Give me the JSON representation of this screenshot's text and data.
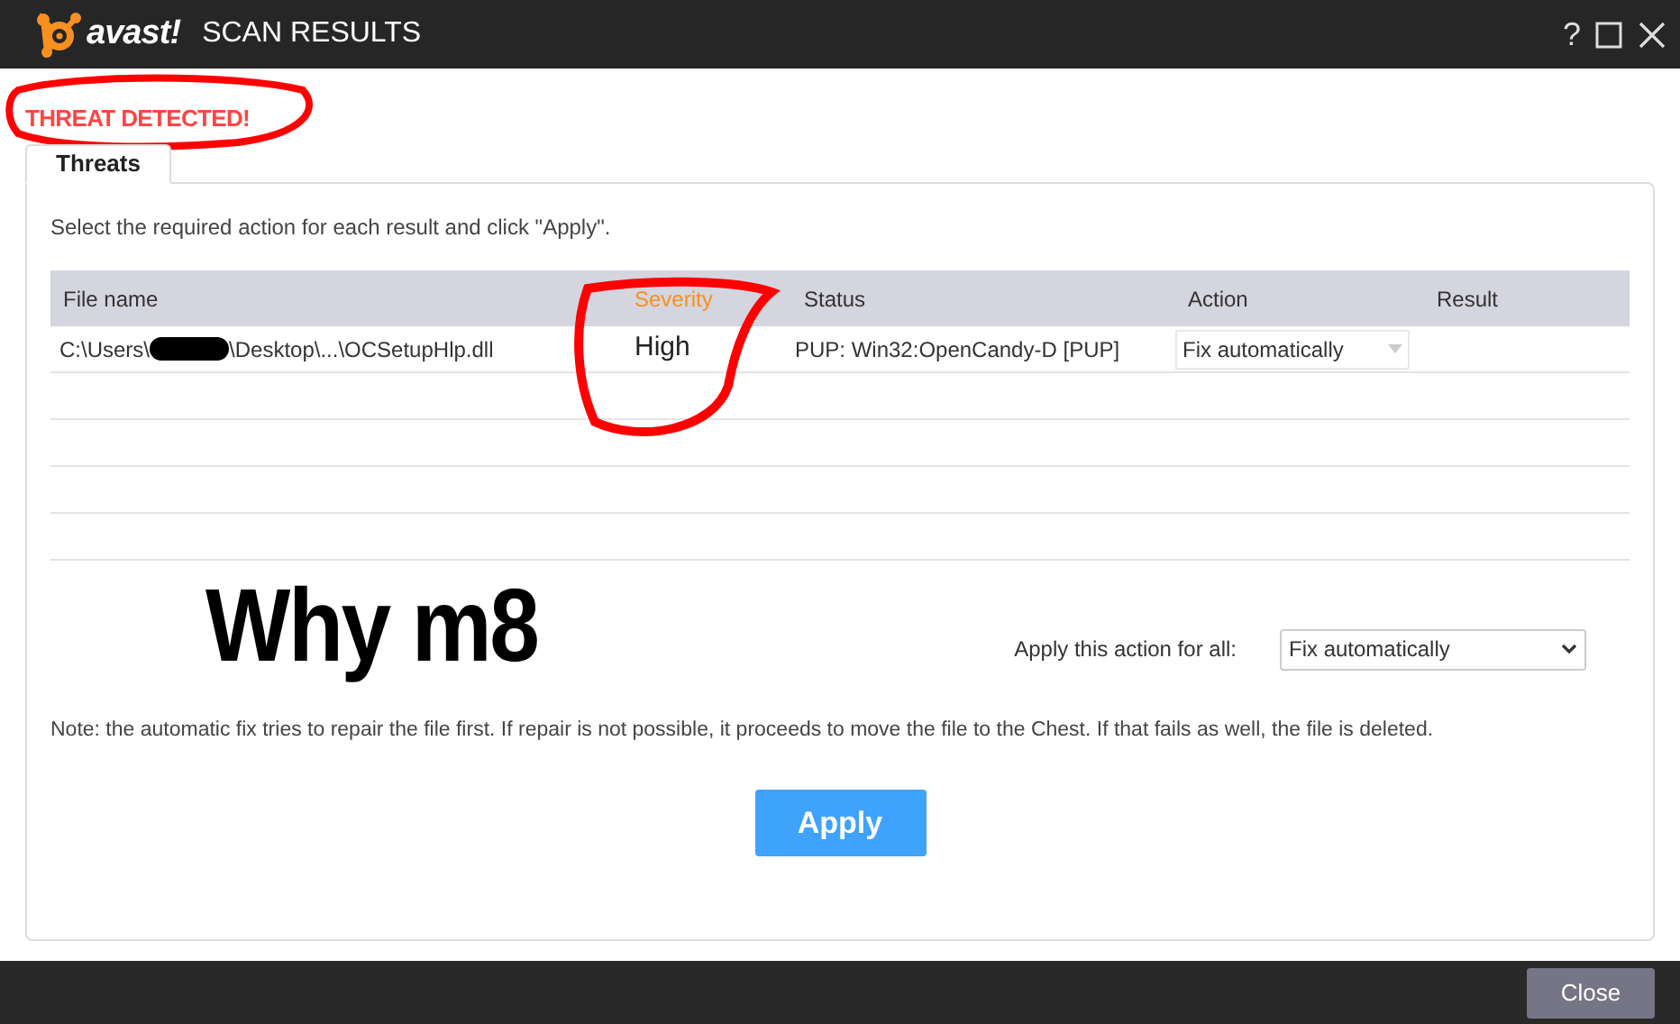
{
  "window": {
    "logo": "avast!",
    "title": "SCAN RESULTS",
    "controls": [
      "?"
    ]
  },
  "alert": "THREAT DETECTED!",
  "tabs": [
    {
      "label": "Threats",
      "selected": true
    }
  ],
  "instruction": "Select the required action for each result and click \"Apply\".",
  "table": {
    "columns": [
      {
        "label": "File name",
        "sorted": false
      },
      {
        "label": "Severity",
        "sorted": true
      },
      {
        "label": "Status",
        "sorted": false
      },
      {
        "label": "Action",
        "sorted": false
      },
      {
        "label": "Result",
        "sorted": false
      }
    ],
    "rows": [
      {
        "file_name_start": "C:\\Users\\",
        "file_name_end": "\\Desktop\\...\\OCSetupHlp.dll",
        "severity": "High",
        "status": "PUP: Win32:OpenCandy-D [PUP]",
        "action": "Fix automatically"
      }
    ]
  },
  "caption": "Why m8",
  "apply_all": {
    "label": "Apply this action for all:",
    "value": "Fix automatically"
  },
  "note": "Note: the automatic fix tries to repair the file first. If repair is not possible, it proceeds to move the file to the Chest. If that fails as well, the file is deleted.",
  "apply_button": "Apply",
  "close_button": "Close"
}
